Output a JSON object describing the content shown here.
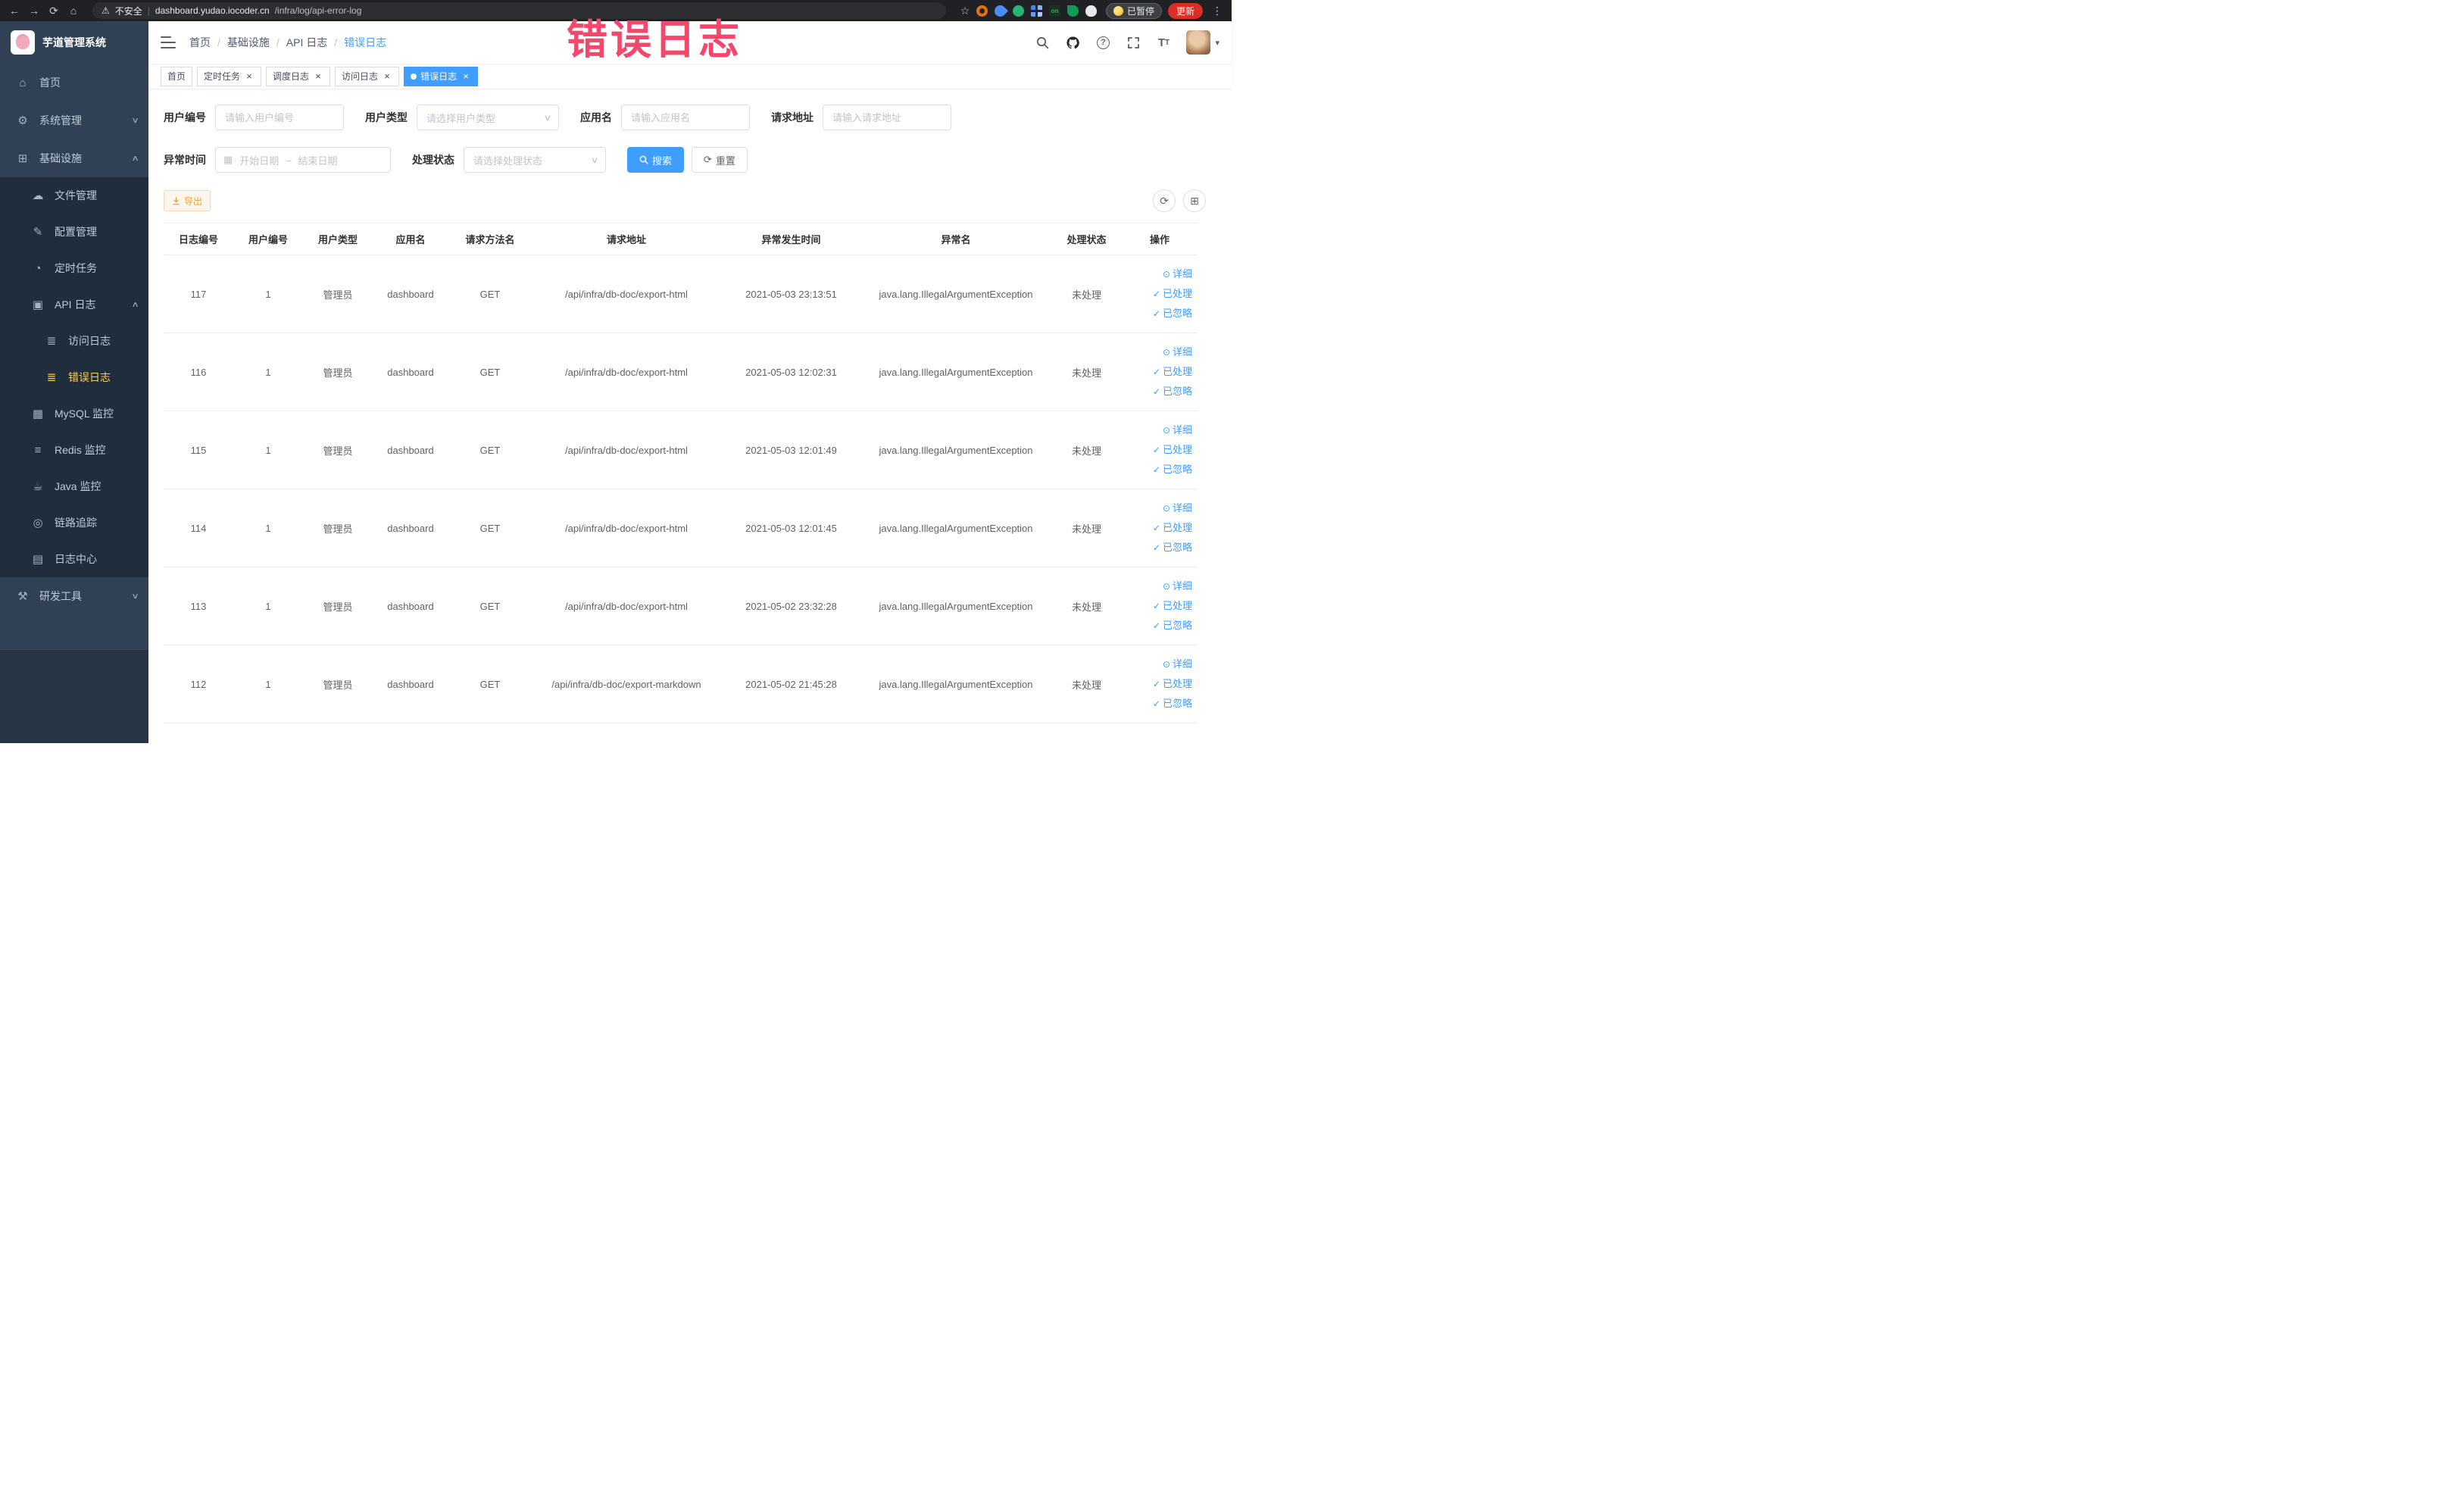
{
  "icons": {
    "back": "←",
    "forward": "→",
    "reload": "⟳",
    "home": "⌂",
    "warning": "⚠",
    "star": "☆",
    "kebab": "⋮",
    "divider": "|",
    "question": "?",
    "font_t_big": "T",
    "font_t_small": "T",
    "caret_down": "▾",
    "chevron_down": "∨",
    "chevron_up": "∧",
    "menu_home": "⌂",
    "menu_system": "⚙",
    "menu_infra": "⊞",
    "menu_file": "☁",
    "menu_config": "✎",
    "menu_job": "◔",
    "menu_api_log": "▣",
    "menu_doc": "≣",
    "menu_mysql": "▦",
    "menu_redis": "≡",
    "menu_java": "☕",
    "menu_trace": "◎",
    "menu_log_center": "▤",
    "menu_tools": "⚒",
    "calendar": "▦",
    "reset": "⟳",
    "refresh": "⟳",
    "columns": "⊞",
    "eye": "⊙",
    "check": "✓",
    "close": "×",
    "dash": "–"
  },
  "browser": {
    "security_label": "不安全",
    "url_domain": "dashboard.yudao.iocoder.cn",
    "url_path": "/infra/log/api-error-log",
    "ext_on": "on",
    "paused_label": "已暂停",
    "update_label": "更新"
  },
  "annotation": {
    "text": "错误日志"
  },
  "sidebar": {
    "logo_title": "芋道管理系统",
    "items": [
      {
        "label": "首页"
      },
      {
        "label": "系统管理"
      },
      {
        "label": "基础设施"
      },
      {
        "label": "文件管理"
      },
      {
        "label": "配置管理"
      },
      {
        "label": "定时任务"
      },
      {
        "label": "API 日志"
      },
      {
        "label": "访问日志"
      },
      {
        "label": "错误日志"
      },
      {
        "label": "MySQL 监控"
      },
      {
        "label": "Redis 监控"
      },
      {
        "label": "Java 监控"
      },
      {
        "label": "链路追踪"
      },
      {
        "label": "日志中心"
      },
      {
        "label": "研发工具"
      }
    ]
  },
  "header": {
    "breadcrumb": [
      "首页",
      "基础设施",
      "API 日志",
      "错误日志"
    ],
    "breadcrumb_separator": "/"
  },
  "tabs": [
    {
      "label": "首页"
    },
    {
      "label": "定时任务"
    },
    {
      "label": "调度日志"
    },
    {
      "label": "访问日志"
    },
    {
      "label": "错误日志"
    }
  ],
  "filters": {
    "user_id": {
      "label": "用户编号",
      "placeholder": "请输入用户编号"
    },
    "user_type": {
      "label": "用户类型",
      "placeholder": "请选择用户类型"
    },
    "app_name": {
      "label": "应用名",
      "placeholder": "请输入应用名"
    },
    "request_url": {
      "label": "请求地址",
      "placeholder": "请输入请求地址"
    },
    "exception_time": {
      "label": "异常时间",
      "start_placeholder": "开始日期",
      "separator": "–",
      "end_placeholder": "结束日期"
    },
    "process_status": {
      "label": "处理状态",
      "placeholder": "请选择处理状态"
    },
    "search_label": "搜索",
    "reset_label": "重置"
  },
  "toolbar": {
    "export_label": "导出"
  },
  "table": {
    "columns": [
      "日志编号",
      "用户编号",
      "用户类型",
      "应用名",
      "请求方法名",
      "请求地址",
      "异常发生时间",
      "异常名",
      "处理状态",
      "操作"
    ],
    "actions": {
      "detail": "详细",
      "processed": "已处理",
      "ignored": "已忽略"
    },
    "rows": [
      {
        "id": "117",
        "user_id": "1",
        "user_type": "管理员",
        "app_name": "dashboard",
        "method": "GET",
        "url": "/api/infra/db-doc/export-html",
        "time": "2021-05-03 23:13:51",
        "exception": "java.lang.IllegalArgumentException",
        "status": "未处理"
      },
      {
        "id": "116",
        "user_id": "1",
        "user_type": "管理员",
        "app_name": "dashboard",
        "method": "GET",
        "url": "/api/infra/db-doc/export-html",
        "time": "2021-05-03 12:02:31",
        "exception": "java.lang.IllegalArgumentException",
        "status": "未处理"
      },
      {
        "id": "115",
        "user_id": "1",
        "user_type": "管理员",
        "app_name": "dashboard",
        "method": "GET",
        "url": "/api/infra/db-doc/export-html",
        "time": "2021-05-03 12:01:49",
        "exception": "java.lang.IllegalArgumentException",
        "status": "未处理"
      },
      {
        "id": "114",
        "user_id": "1",
        "user_type": "管理员",
        "app_name": "dashboard",
        "method": "GET",
        "url": "/api/infra/db-doc/export-html",
        "time": "2021-05-03 12:01:45",
        "exception": "java.lang.IllegalArgumentException",
        "status": "未处理"
      },
      {
        "id": "113",
        "user_id": "1",
        "user_type": "管理员",
        "app_name": "dashboard",
        "method": "GET",
        "url": "/api/infra/db-doc/export-html",
        "time": "2021-05-02 23:32:28",
        "exception": "java.lang.IllegalArgumentException",
        "status": "未处理"
      },
      {
        "id": "112",
        "user_id": "1",
        "user_type": "管理员",
        "app_name": "dashboard",
        "method": "GET",
        "url": "/api/infra/db-doc/export-markdown",
        "time": "2021-05-02 21:45:28",
        "exception": "java.lang.IllegalArgumentException",
        "status": "未处理"
      }
    ]
  }
}
